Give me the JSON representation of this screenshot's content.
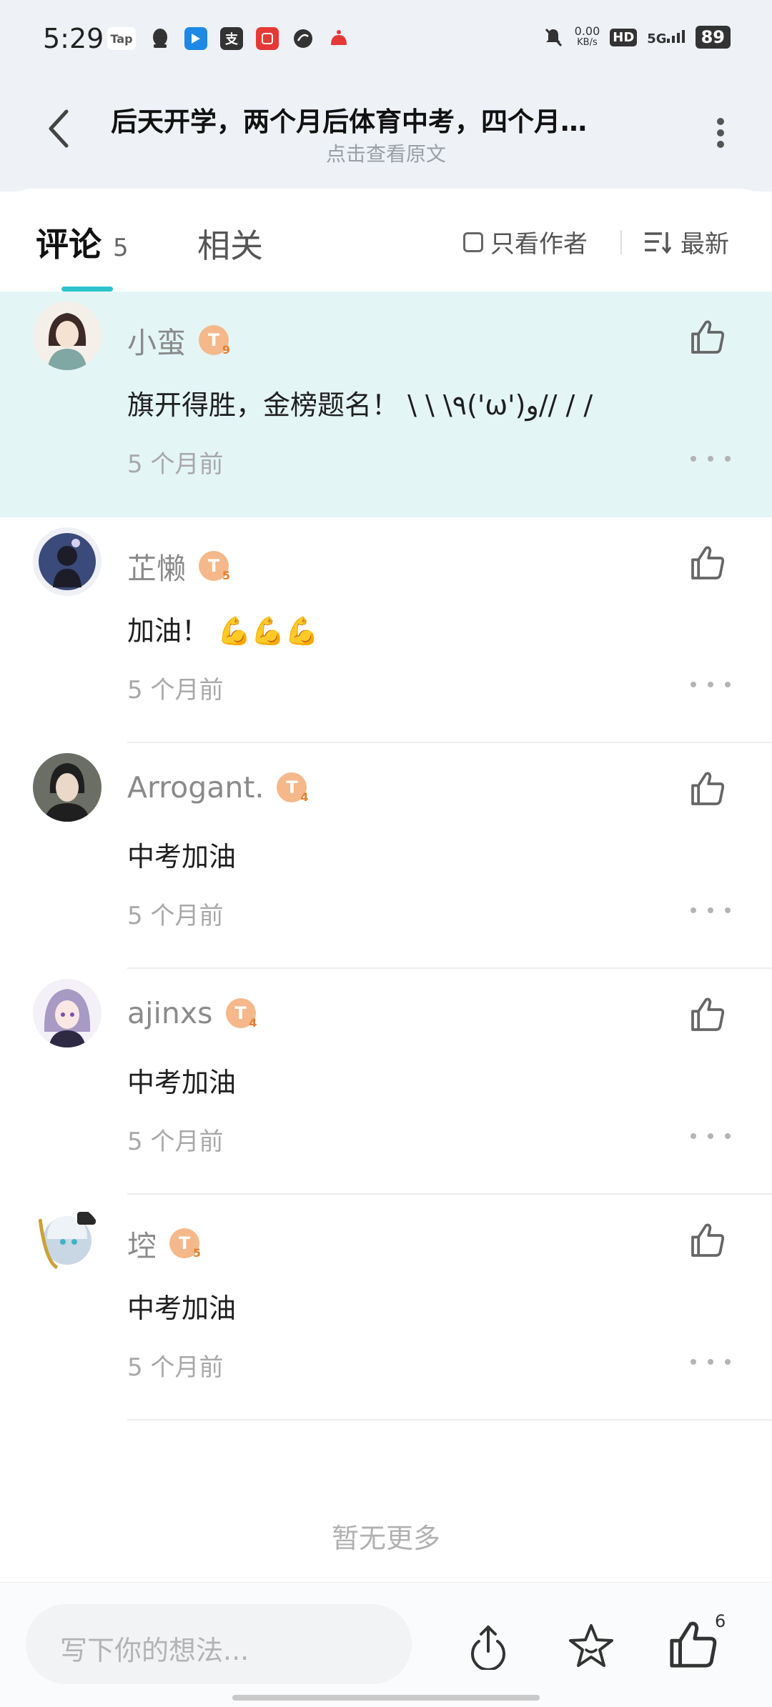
{
  "status_bar": {
    "time": "5:29",
    "apps": [
      {
        "icon": "taptap-icon",
        "text": "Tap",
        "color": "#555555"
      },
      {
        "icon": "qq-icon",
        "text": "",
        "color": "#333333"
      },
      {
        "icon": "bilibili-icon",
        "text": "",
        "color": "#1e88e5"
      },
      {
        "icon": "alipay-icon",
        "text": "支",
        "color": "#333333"
      },
      {
        "icon": "xiaohongshu-icon",
        "text": "",
        "color": "#e53935"
      },
      {
        "icon": "browser-icon",
        "text": "",
        "color": "#333333"
      },
      {
        "icon": "game-icon",
        "text": "",
        "color": "#e53935"
      }
    ],
    "net_speed": "0.00",
    "net_unit": "KB/s",
    "hd": "HD",
    "network": "5G",
    "battery": "89"
  },
  "header": {
    "title": "后天开学，两个月后体育中考，四个月…",
    "subtitle": "点击查看原文"
  },
  "tabs": {
    "comments_label": "评论",
    "comments_count": "5",
    "related_label": "相关",
    "author_only_label": "只看作者",
    "sort_label": "最新"
  },
  "accent_color": "#2bc4cc",
  "comments": [
    {
      "username": "小蛮",
      "level": "T",
      "level_num": "9",
      "text": "旗开得胜，金榜题名！ \\ \\ \\٩('ω')و// / /",
      "time": "5 个月前",
      "highlighted": true
    },
    {
      "username": "芷懒",
      "level": "T",
      "level_num": "5",
      "text": "加油！ 💪💪💪",
      "time": "5 个月前",
      "highlighted": false
    },
    {
      "username": "Arrogant.",
      "level": "T",
      "level_num": "4",
      "text": "中考加油",
      "time": "5 个月前",
      "highlighted": false
    },
    {
      "username": "ajinxs",
      "level": "T",
      "level_num": "4",
      "text": "中考加油",
      "time": "5 个月前",
      "highlighted": false
    },
    {
      "username": "埪",
      "level": "T",
      "level_num": "5",
      "text": "中考加油",
      "time": "5 个月前",
      "highlighted": false
    }
  ],
  "footer": {
    "no_more": "暂无更多",
    "input_placeholder": "写下你的想法...",
    "like_count": "6"
  }
}
